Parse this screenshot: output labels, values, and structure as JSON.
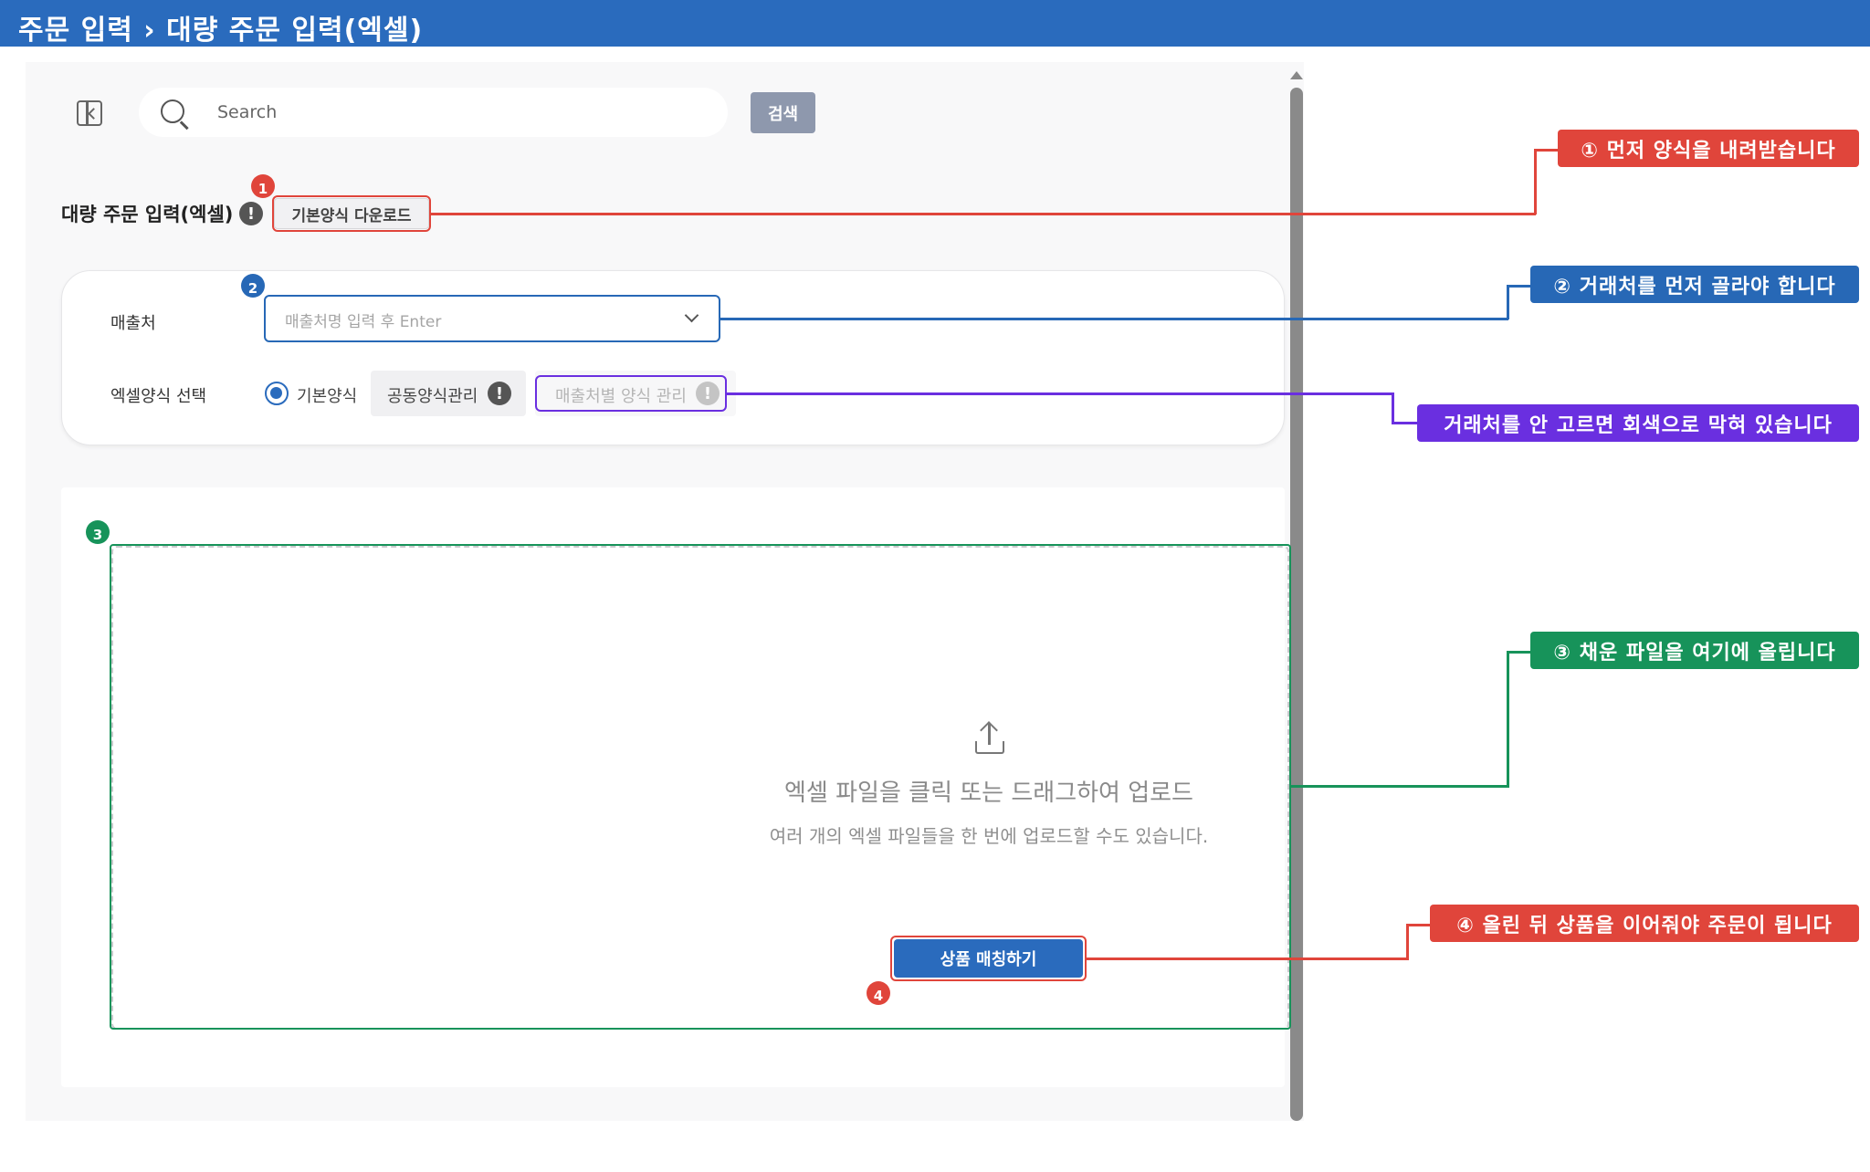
{
  "header": {
    "title": "주문 입력 › 대량 주문 입력(엑셀)"
  },
  "toolbar": {
    "search_placeholder": "Search",
    "search_button": "검색"
  },
  "page": {
    "title": "대량 주문 입력(엑셀)",
    "info_icon": "!",
    "download_button": "기본양식 다운로드"
  },
  "form": {
    "vendor_label": "매출처",
    "vendor_placeholder": "매출처명 입력 후 Enter",
    "format_label": "엑셀양식 선택",
    "radio_default": "기본양식",
    "common_format_button": "공동양식관리",
    "vendor_format_button": "매출처별 양식 관리",
    "info_icon": "!"
  },
  "upload": {
    "main_text": "엑셀 파일을 클릭 또는 드래그하여 업로드",
    "sub_text": "여러 개의 엑셀 파일들을 한 번에 업로드할 수도 있습니다.",
    "match_button": "상품 매칭하기"
  },
  "badges": [
    "1",
    "2",
    "3",
    "4"
  ],
  "callouts": {
    "c1": "① 먼저 양식을 내려받습니다",
    "c2": "② 거래처를 먼저 골라야 합니다",
    "c_gray": "거래처를 안 고르면 회색으로 막혀 있습니다",
    "c3": "③ 채운 파일을 여기에 올립니다",
    "c4": "④ 올린 뒤 상품을 이어줘야 주문이 됩니다"
  },
  "colors": {
    "header_blue": "#2a6bbd",
    "annotation_red": "#e0453b",
    "annotation_blue": "#2768b6",
    "annotation_purple": "#6a2fe0",
    "annotation_green": "#17935a",
    "search_button_gray": "#8e98ad"
  },
  "icons": [
    "sidebar-toggle-icon",
    "search-icon",
    "info-icon",
    "chevron-down-icon",
    "upload-icon"
  ]
}
